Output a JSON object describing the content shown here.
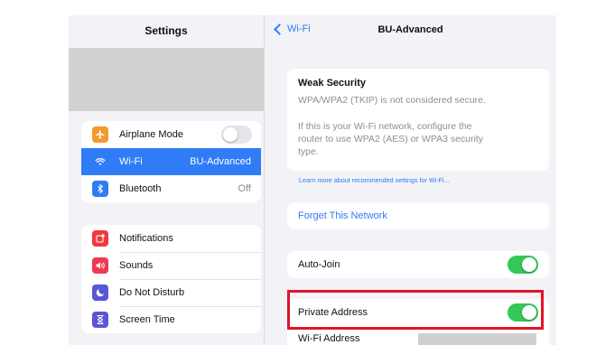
{
  "sidebar": {
    "title": "Settings",
    "group1": [
      {
        "label": "Airplane Mode",
        "icon": "airplane-icon",
        "icon_color": "#f39a2b",
        "control": "toggle-off",
        "value": ""
      },
      {
        "label": "Wi-Fi",
        "icon": "wifi-icon",
        "icon_color": "#2f7cf6",
        "value": "BU-Advanced",
        "selected": true
      },
      {
        "label": "Bluetooth",
        "icon": "bluetooth-icon",
        "icon_color": "#2f7cf6",
        "value": "Off"
      }
    ],
    "group2": [
      {
        "label": "Notifications",
        "icon": "notifications-icon",
        "icon_color": "#f0393c"
      },
      {
        "label": "Sounds",
        "icon": "sounds-icon",
        "icon_color": "#f0394f"
      },
      {
        "label": "Do Not Disturb",
        "icon": "moon-icon",
        "icon_color": "#5a56d6"
      },
      {
        "label": "Screen Time",
        "icon": "hourglass-icon",
        "icon_color": "#5a56d6"
      }
    ]
  },
  "detail": {
    "back_label": "Wi-Fi",
    "title": "BU-Advanced",
    "weak_security": {
      "title": "Weak Security",
      "line1": "WPA/WPA2 (TKIP) is not considered secure.",
      "line2": "If this is your Wi-Fi network, configure the",
      "line3": "router to use WPA2 (AES) or WPA3 security",
      "line4": "type."
    },
    "learn_more": "Learn more about recommended settings for Wi-Fi...",
    "forget": "Forget This Network",
    "auto_join": {
      "label": "Auto-Join",
      "state": "on"
    },
    "private_address": {
      "label": "Private Address",
      "state": "on"
    },
    "wifi_address_label": "Wi-Fi Address"
  },
  "colors": {
    "accent": "#2f7cf6",
    "toggle_on": "#34c759",
    "highlight": "#e0142a"
  }
}
